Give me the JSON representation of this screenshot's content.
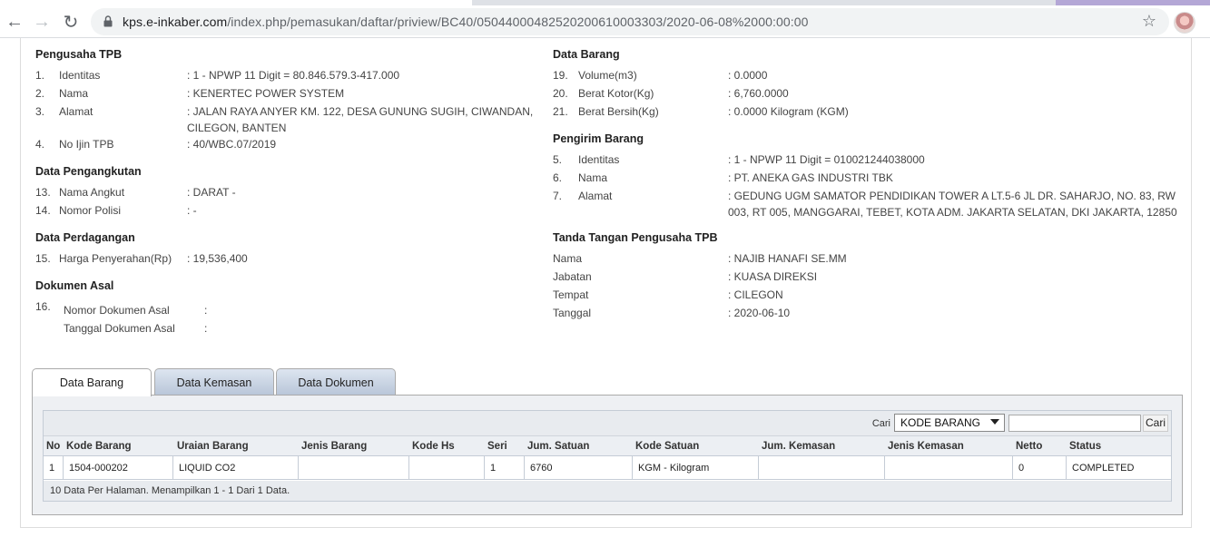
{
  "browser": {
    "url_host": "kps.e-inkaber.com",
    "url_path": "/index.php/pemasukan/daftar/priview/BC40/05044000482520200610003303/2020-06-08%2000:00:00"
  },
  "pengusaha": {
    "title": "Pengusaha TPB",
    "rows": [
      {
        "num": "1.",
        "label": "Identitas",
        "value": ": 1 - NPWP 11 Digit = 80.846.579.3-417.000"
      },
      {
        "num": "2.",
        "label": "Nama",
        "value": ": KENERTEC POWER SYSTEM"
      },
      {
        "num": "3.",
        "label": "Alamat",
        "value": ": JALAN RAYA ANYER KM. 122, DESA GUNUNG SUGIH, CIWANDAN, CILEGON, BANTEN"
      },
      {
        "num": "4.",
        "label": "No Ijin TPB",
        "value": ": 40/WBC.07/2019"
      }
    ]
  },
  "pengangkutan": {
    "title": "Data Pengangkutan",
    "rows": [
      {
        "num": "13.",
        "label": "Nama Angkut",
        "value": ": DARAT -"
      },
      {
        "num": "14.",
        "label": "Nomor Polisi",
        "value": ": -"
      }
    ]
  },
  "perdagangan": {
    "title": "Data Perdagangan",
    "rows": [
      {
        "num": "15.",
        "label": "Harga Penyerahan(Rp)",
        "value": ": 19,536,400"
      }
    ]
  },
  "dokumen_asal": {
    "title": "Dokumen Asal",
    "num": "16.",
    "rows": [
      {
        "label": "Nomor Dokumen Asal",
        "value": ":"
      },
      {
        "label": "Tanggal Dokumen Asal",
        "value": ":"
      }
    ]
  },
  "data_barang": {
    "title": "Data Barang",
    "rows": [
      {
        "num": "19.",
        "label": "Volume(m3)",
        "value": ": 0.0000"
      },
      {
        "num": "20.",
        "label": "Berat Kotor(Kg)",
        "value": ": 6,760.0000"
      },
      {
        "num": "21.",
        "label": "Berat Bersih(Kg)",
        "value": ": 0.0000 Kilogram (KGM)"
      }
    ]
  },
  "pengirim": {
    "title": "Pengirim Barang",
    "rows": [
      {
        "num": "5.",
        "label": "Identitas",
        "value": ": 1 - NPWP 11 Digit = 010021244038000"
      },
      {
        "num": "6.",
        "label": "Nama",
        "value": ": PT. ANEKA GAS INDUSTRI TBK"
      },
      {
        "num": "7.",
        "label": "Alamat",
        "value": ": GEDUNG UGM SAMATOR PENDIDIKAN TOWER A LT.5-6 JL DR. SAHARJO, NO. 83, RW 003, RT 005, MANGGARAI, TEBET, KOTA ADM. JAKARTA SELATAN, DKI JAKARTA, 12850"
      }
    ]
  },
  "tanda_tangan": {
    "title": "Tanda Tangan Pengusaha TPB",
    "rows": [
      {
        "label": "Nama",
        "value": ": NAJIB HANAFI SE.MM"
      },
      {
        "label": "Jabatan",
        "value": ": KUASA DIREKSI"
      },
      {
        "label": "Tempat",
        "value": ": CILEGON"
      },
      {
        "label": "Tanggal",
        "value": ": 2020-06-10"
      }
    ]
  },
  "tabs": [
    {
      "label": "Data Barang",
      "active": true
    },
    {
      "label": "Data Kemasan",
      "active": false
    },
    {
      "label": "Data Dokumen",
      "active": false
    }
  ],
  "grid": {
    "search_label": "Cari",
    "search_field": "KODE BARANG",
    "search_button": "Cari",
    "columns": [
      "No",
      "Kode Barang",
      "Uraian Barang",
      "Jenis Barang",
      "Kode Hs",
      "Seri",
      "Jum. Satuan",
      "Kode Satuan",
      "Jum. Kemasan",
      "Jenis Kemasan",
      "Netto",
      "Status"
    ],
    "rows": [
      [
        "1",
        "1504-000202",
        "LIQUID CO2",
        "",
        "",
        "1",
        "6760",
        "KGM - Kilogram",
        "",
        "",
        "0",
        "COMPLETED"
      ]
    ],
    "footer": "10 Data Per Halaman. Menampilkan 1 - 1 Dari 1 Data."
  }
}
